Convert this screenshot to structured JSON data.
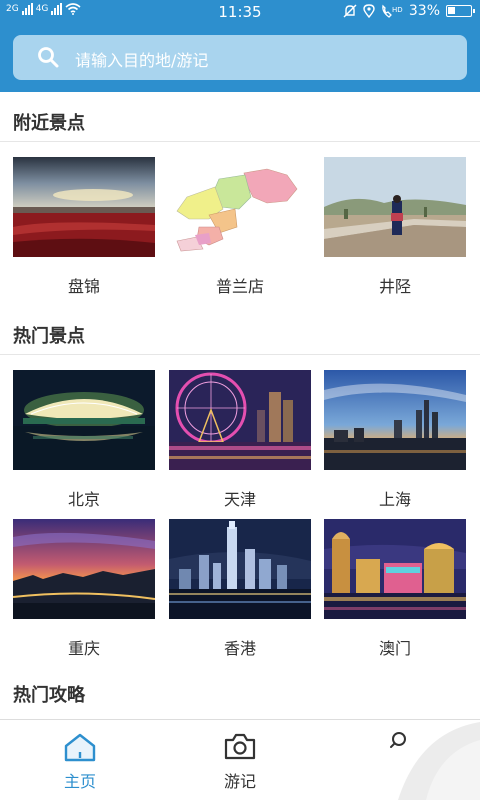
{
  "status_bar": {
    "network_1": "2G",
    "network_2": "4G",
    "time": "11:35",
    "battery_percent": "33%",
    "battery_level": 0.33
  },
  "search": {
    "placeholder": "请输入目的地/游记",
    "icon": "search-icon"
  },
  "nearby": {
    "title": "附近景点",
    "items": [
      {
        "label": "盘锦"
      },
      {
        "label": "普兰店"
      },
      {
        "label": "井陉"
      }
    ]
  },
  "hot": {
    "title": "热门景点",
    "items": [
      {
        "label": "北京"
      },
      {
        "label": "天津"
      },
      {
        "label": "上海"
      },
      {
        "label": "重庆"
      },
      {
        "label": "香港"
      },
      {
        "label": "澳门"
      }
    ]
  },
  "guides": {
    "title": "热门攻略"
  },
  "bottom_nav": {
    "items": [
      {
        "label": "主页",
        "icon": "home-icon",
        "active": true
      },
      {
        "label": "游记",
        "icon": "camera-icon",
        "active": false
      },
      {
        "label": "",
        "icon": "search-icon",
        "active": false
      }
    ]
  },
  "colors": {
    "header": "#2d8fce",
    "search_bg": "#a9d4ee",
    "active_tab": "#2d8fce",
    "text": "#333333"
  }
}
